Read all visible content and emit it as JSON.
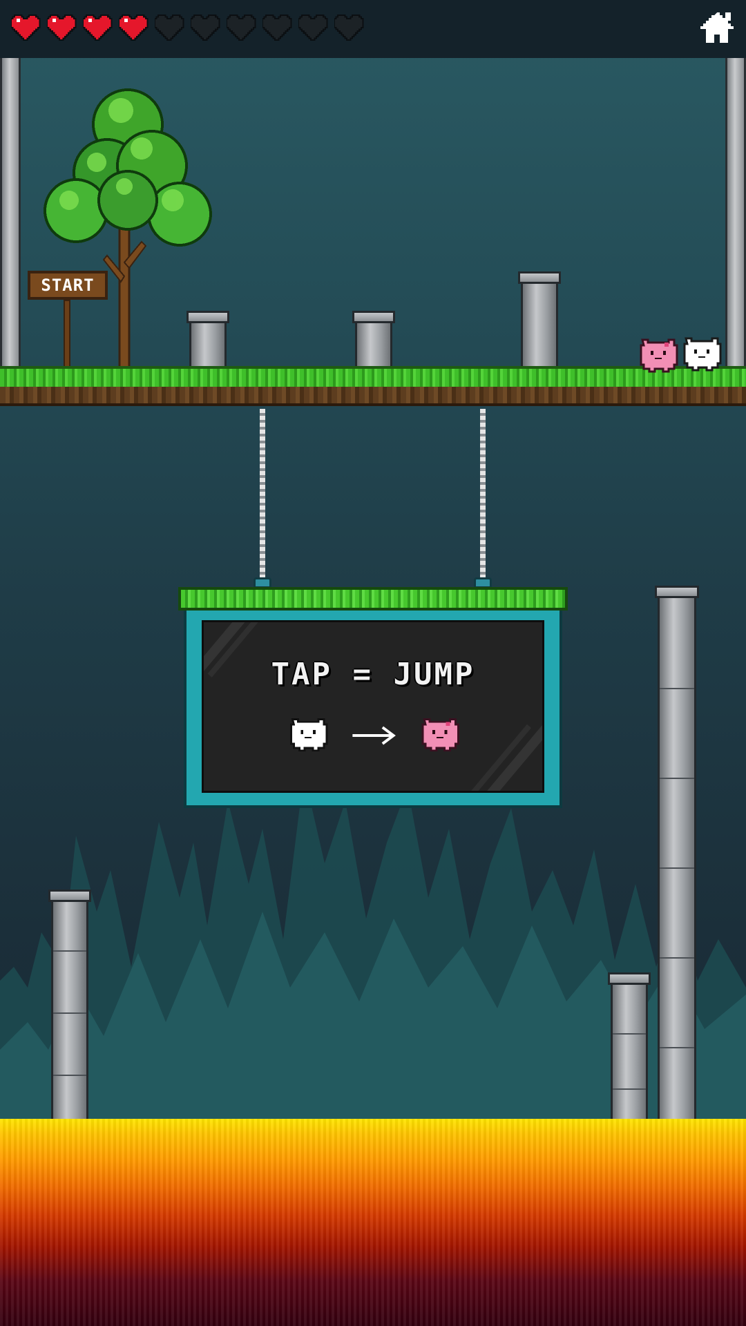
{
  "hud": {
    "lives_total": 10,
    "lives_remaining": 4,
    "heart_full_color": "#e5172b",
    "heart_empty_color": "#1c2226",
    "home_icon": "home-icon"
  },
  "scene": {
    "start_sign_label": "START",
    "tutorial_title": "TAP = JUMP",
    "demo_icons": [
      "white-cat-icon",
      "arrow-right-icon",
      "pink-cat-icon"
    ]
  },
  "colors": {
    "sky_top": "#2a5a63",
    "sky_bottom": "#172630",
    "grass": "#3fbf2a",
    "board_frame": "#23a7b0",
    "lava_top": "#ffe600",
    "lava_bottom": "#32000f",
    "cat_white": "#ffffff",
    "cat_pink": "#f28fb5"
  }
}
